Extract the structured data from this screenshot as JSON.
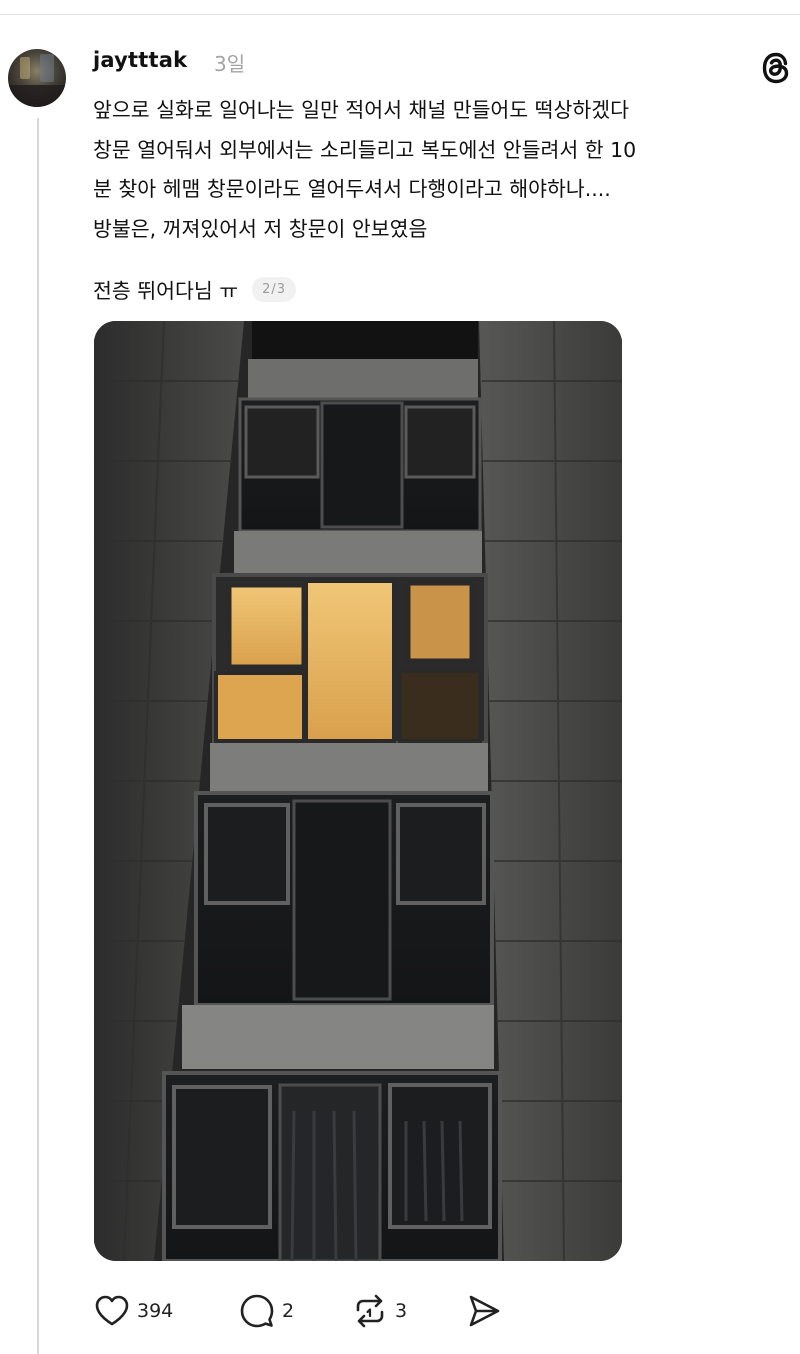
{
  "post": {
    "username": "jaytttak",
    "timestamp": "3일",
    "lines": [
      "앞으로 실화로 일어나는 일만 적어서 채널 만들어도 떡상하겠다",
      "창문 열어둬서 외부에서는 소리들리고 복도에선 안들려서 한 10",
      "분 찾아 헤맴 창문이라도 열어두셔서 다행이라고 해야하나....",
      "방불은, 꺼져있어서 저 창문이 안보였음",
      "전층 뛰어다님 ㅠ"
    ],
    "page_indicator": "2/3"
  },
  "actions": {
    "likes": "394",
    "replies": "2",
    "reposts": "3"
  },
  "icons": {
    "brand": "threads-logo-icon",
    "like": "heart-icon",
    "reply": "comment-icon",
    "repost": "repost-icon",
    "share": "send-icon"
  },
  "colors": {
    "text": "#111111",
    "muted": "#a3a3a3",
    "divider": "#d9d9d9",
    "lit_window": "#e9b765"
  }
}
